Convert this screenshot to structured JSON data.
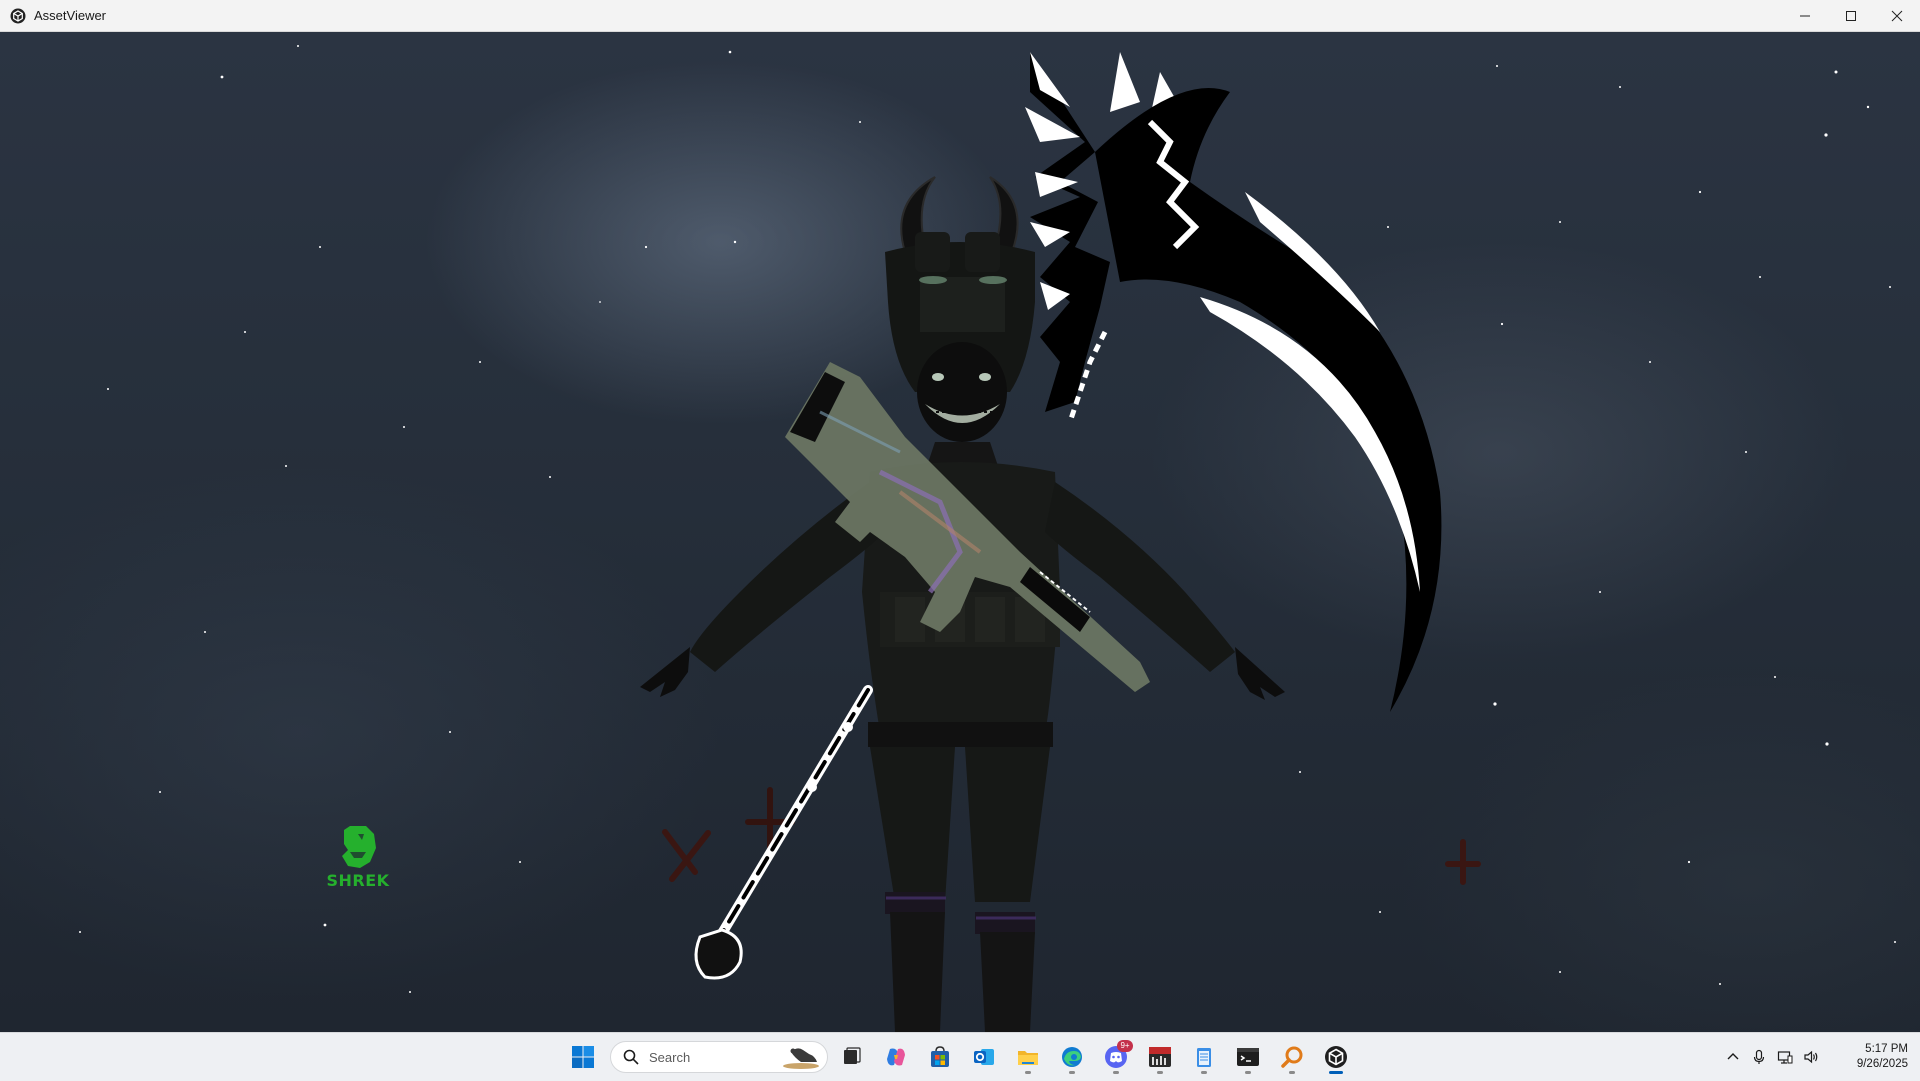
{
  "window": {
    "title": "AssetViewer",
    "controls": [
      "minimize",
      "maximize",
      "close"
    ]
  },
  "viewport": {
    "scene": "3D character model: horned helmeted soldier holding a rifle, with a black-and-white scythe and bone staff, inverted crosses, over a starry night sky",
    "logo_text": "SHREK"
  },
  "taskbar": {
    "search_placeholder": "Search",
    "apps": [
      {
        "name": "task-view",
        "icon": "task-view-icon",
        "running": false
      },
      {
        "name": "copilot",
        "icon": "copilot-icon",
        "running": false
      },
      {
        "name": "microsoft-store",
        "icon": "store-icon",
        "running": false
      },
      {
        "name": "outlook",
        "icon": "outlook-icon",
        "running": false
      },
      {
        "name": "file-explorer",
        "icon": "folder-icon",
        "running": true
      },
      {
        "name": "edge",
        "icon": "edge-icon",
        "running": true
      },
      {
        "name": "discord",
        "icon": "discord-icon",
        "running": true,
        "badge": "9+"
      },
      {
        "name": "voicemeeter",
        "icon": "voicemeeter-icon",
        "running": true,
        "label": "VOICE"
      },
      {
        "name": "notepad",
        "icon": "notepad-icon",
        "running": true
      },
      {
        "name": "terminal",
        "icon": "terminal-icon",
        "running": true
      },
      {
        "name": "search-tool",
        "icon": "magnifier-icon",
        "running": true
      },
      {
        "name": "assetviewer",
        "icon": "assetviewer-icon",
        "running": true,
        "active": true
      }
    ],
    "tray": [
      "chevron-up-icon",
      "microphone-icon",
      "network-icon",
      "volume-icon"
    ],
    "time": "5:17 PM",
    "date": "9/26/2025"
  },
  "colors": {
    "logo_green": "#25b02d",
    "active_indicator": "#005fb8",
    "sky_dark": "#1f2630"
  }
}
